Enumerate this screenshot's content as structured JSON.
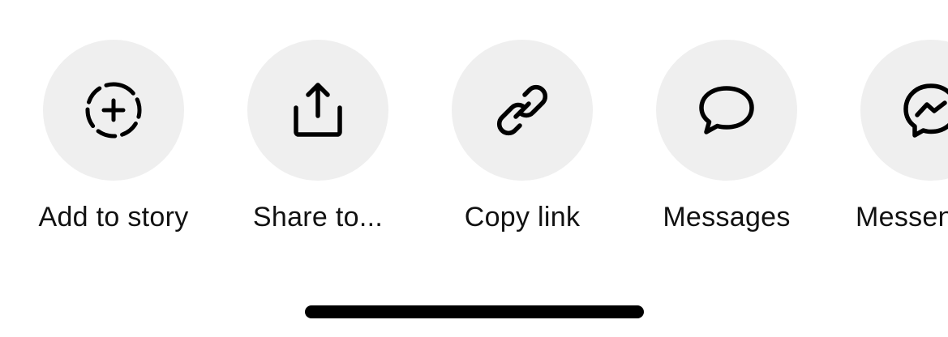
{
  "share_sheet": {
    "actions": [
      {
        "label": "Add to story",
        "icon": "add-to-story-icon"
      },
      {
        "label": "Share to...",
        "icon": "share-icon"
      },
      {
        "label": "Copy link",
        "icon": "link-icon"
      },
      {
        "label": "Messages",
        "icon": "message-bubble-icon"
      },
      {
        "label": "Messenger",
        "icon": "messenger-icon"
      }
    ]
  },
  "colors": {
    "background": "#ffffff",
    "icon_circle": "#efefef",
    "icon_stroke": "#000000",
    "label_text": "#111111",
    "home_indicator": "#000000"
  }
}
